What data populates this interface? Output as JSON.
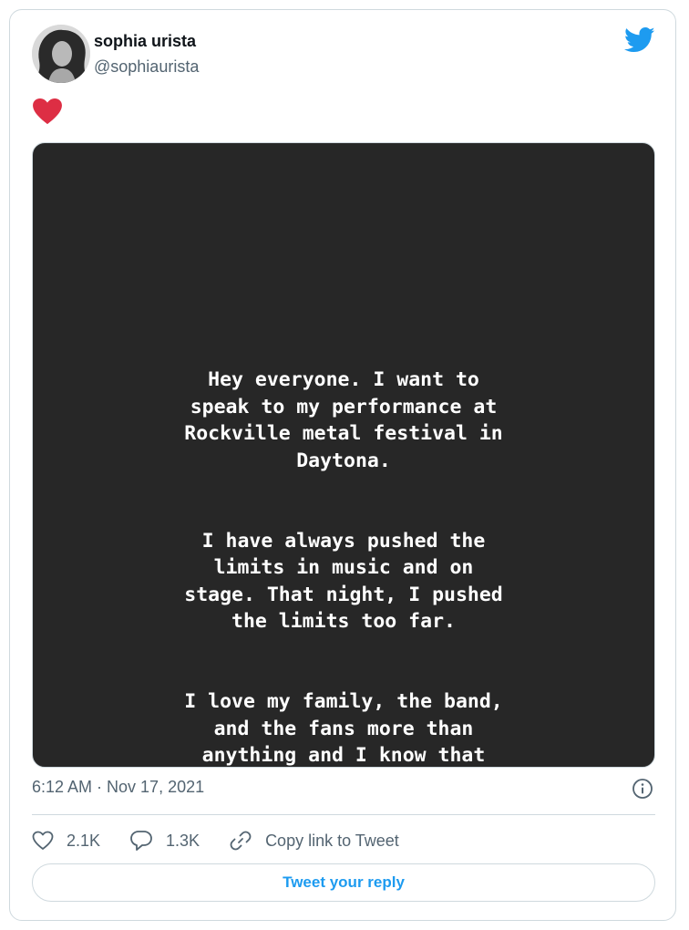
{
  "tweet": {
    "author_name": "sophia urista",
    "author_handle": "@sophiaurista",
    "story_paragraphs": [
      "Hey everyone. I want to\nspeak to my performance at\nRockville metal festival in\nDaytona.",
      "I have always pushed the\nlimits in music and on\nstage. That night, I pushed\nthe limits too far.",
      "I love my family, the band,\nand the fans more than\nanything and I know that\nsome were hurt or offended\nby what I did. I apologize\nto them and want them to"
    ],
    "timestamp": "6:12 AM · Nov 17, 2021"
  },
  "actions": {
    "likes": "2.1K",
    "replies": "1.3K",
    "copy_link": "Copy link to Tweet"
  },
  "reply_button": "Tweet your reply",
  "colors": {
    "accent": "#1d9bf0",
    "heart": "#dd2e44",
    "media_bg": "#272727",
    "muted_text": "#536471"
  },
  "icons": [
    "twitter-bird-icon",
    "heart-emoji",
    "info-icon",
    "heart-icon",
    "reply-icon",
    "link-icon"
  ]
}
